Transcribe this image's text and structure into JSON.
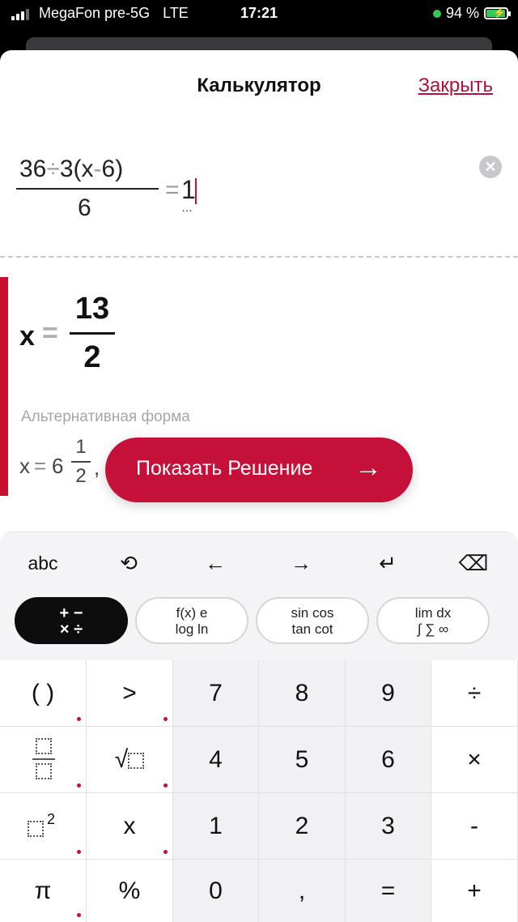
{
  "status_bar": {
    "carrier": "MegaFon pre-5G",
    "network": "LTE",
    "time": "17:21",
    "battery": "94 %"
  },
  "header": {
    "title": "Калькулятор",
    "close_label": "Закрыть"
  },
  "input": {
    "numerator_a": "36",
    "div_op": "÷",
    "numerator_b": "3(x",
    "minus": "-",
    "numerator_c": "6)",
    "denominator": "6",
    "equals": "=",
    "rhs": "1",
    "dots": "…"
  },
  "result": {
    "variable": "x",
    "equals": "=",
    "numerator": "13",
    "denominator": "2",
    "alt_label": "Альтернативная форма",
    "alt": {
      "variable": "x",
      "equals": "=",
      "whole": "6",
      "numerator": "1",
      "denominator": "2",
      "comma": ","
    }
  },
  "show_solution": {
    "label": "Показать Решение",
    "arrow": "→"
  },
  "keyboard": {
    "top_row": {
      "abc": "abc",
      "history": "⟲",
      "left": "←",
      "right": "→",
      "enter": "↵",
      "backspace": "⌫"
    },
    "categories": [
      {
        "line1": "+ −",
        "line2": "× ÷"
      },
      {
        "line1": "f(x)   e",
        "line2": "log  ln"
      },
      {
        "line1": "sin cos",
        "line2": "tan cot"
      },
      {
        "line1": "lim   dx",
        "line2": "∫ ∑ ∞"
      }
    ],
    "keys": {
      "paren": "( )",
      "gt": ">",
      "k7": "7",
      "k8": "8",
      "k9": "9",
      "div": "÷",
      "sqrt": "√",
      "k4": "4",
      "k5": "5",
      "k6": "6",
      "times": "×",
      "sq_exp": "2",
      "x": "x",
      "k1": "1",
      "k2": "2",
      "k3": "3",
      "minus": "-",
      "pi": "π",
      "percent": "%",
      "k0": "0",
      "comma": ",",
      "equals": "=",
      "plus": "+"
    }
  },
  "colors": {
    "accent": "#c8102e",
    "button": "#c5103a"
  }
}
